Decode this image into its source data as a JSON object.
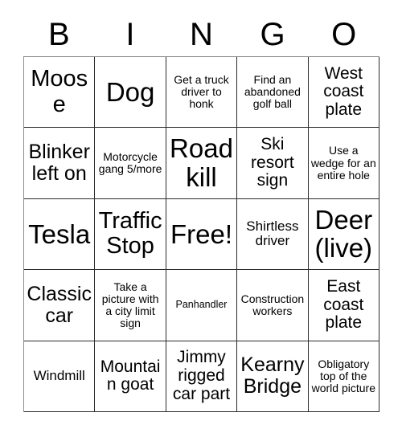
{
  "card": {
    "title": "Bingo Card",
    "header_letters": [
      "B",
      "I",
      "N",
      "G",
      "O"
    ],
    "columns": 5,
    "rows": 5,
    "free_space_label": "Free!",
    "free_space_position": "center",
    "colors": {
      "background": "#ffffff",
      "text": "#000000",
      "grid_line": "#2b2b2b"
    },
    "cells": [
      [
        {
          "text": "Moose",
          "size": "xl"
        },
        {
          "text": "Dog",
          "size": "xxl"
        },
        {
          "text": "Get a truck driver to honk",
          "size": "xs"
        },
        {
          "text": "Find an abandoned golf ball",
          "size": "xs"
        },
        {
          "text": "West coast plate",
          "size": "md"
        }
      ],
      [
        {
          "text": "Blinker left on",
          "size": "lg"
        },
        {
          "text": "Motorcycle gang 5/more",
          "size": "xs"
        },
        {
          "text": "Road kill",
          "size": "xxl"
        },
        {
          "text": "Ski resort sign",
          "size": "md"
        },
        {
          "text": "Use a wedge for an entire hole",
          "size": "xs"
        }
      ],
      [
        {
          "text": "Tesla",
          "size": "xxl"
        },
        {
          "text": "Traffic Stop",
          "size": "xl"
        },
        {
          "text": "Free!",
          "size": "xxl"
        },
        {
          "text": "Shirtless driver",
          "size": "sm"
        },
        {
          "text": "Deer (live)",
          "size": "xxl"
        }
      ],
      [
        {
          "text": "Classic car",
          "size": "lg"
        },
        {
          "text": "Take a picture with a city limit sign",
          "size": "xs"
        },
        {
          "text": "Panhandler",
          "size": "xxs"
        },
        {
          "text": "Construction workers",
          "size": "xs"
        },
        {
          "text": "East coast plate",
          "size": "md"
        }
      ],
      [
        {
          "text": "Windmill",
          "size": "sm"
        },
        {
          "text": "Mountain goat",
          "size": "md"
        },
        {
          "text": "Jimmy rigged car part",
          "size": "md"
        },
        {
          "text": "Kearny Bridge",
          "size": "lg"
        },
        {
          "text": "Obligatory top of the world picture",
          "size": "xs"
        }
      ]
    ]
  }
}
